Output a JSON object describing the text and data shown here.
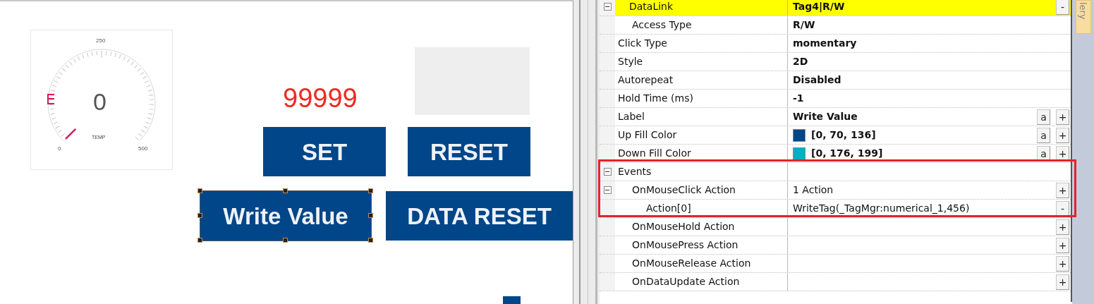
{
  "canvas": {
    "gauge": {
      "value": "0",
      "caption": "TEMP",
      "scale_min": "0",
      "scale_mid": "250",
      "scale_max": "500"
    },
    "numeric_display": {
      "value": "99999"
    },
    "buttons": [
      {
        "label": "SET",
        "selected": false
      },
      {
        "label": "RESET",
        "selected": false
      },
      {
        "label": "Write Value",
        "selected": true
      },
      {
        "label": "DATA RESET",
        "selected": false
      }
    ]
  },
  "properties": [
    {
      "name": "DataLink",
      "value": "Tag4|R/W",
      "bold": true,
      "selected": true,
      "expanded": true,
      "actions": [
        "-"
      ],
      "children": [
        {
          "name": "Access Type",
          "value": "R/W",
          "bold": true,
          "selected": false
        }
      ]
    },
    {
      "name": "Click Type",
      "value": "momentary",
      "bold": true,
      "selected": false
    },
    {
      "name": "Style",
      "value": "2D",
      "bold": true,
      "selected": false
    },
    {
      "name": "Autorepeat",
      "value": "Disabled",
      "bold": true,
      "selected": false
    },
    {
      "name": "Hold Time (ms)",
      "value": "-1",
      "bold": true,
      "selected": false
    },
    {
      "name": "Label",
      "value": "Write Value",
      "bold": true,
      "selected": false,
      "actions": [
        "a",
        "+"
      ]
    },
    {
      "name": "Up Fill Color",
      "value": "[0, 70, 136]",
      "bold": true,
      "color": "#004688",
      "selected": false,
      "actions": [
        "a",
        "+"
      ]
    },
    {
      "name": "Down Fill Color",
      "value": "[0, 176, 199]",
      "bold": true,
      "color": "#00b0c7",
      "selected": false,
      "actions": [
        "a",
        "+"
      ]
    },
    {
      "name": "Events",
      "selected": false,
      "expanded": true,
      "children": [
        {
          "name": "OnMouseClick Action",
          "value": "1 Action",
          "bold": false,
          "selected": false,
          "expanded": true,
          "actions": [
            "+"
          ],
          "children": [
            {
              "name": "Action[0]",
              "value": "WriteTag(_TagMgr:numerical_1,456)",
              "bold": false,
              "selected": false,
              "actions": [
                "-"
              ]
            }
          ]
        },
        {
          "name": "OnMouseHold Action",
          "selected": false,
          "actions": [
            "+"
          ]
        },
        {
          "name": "OnMousePress Action",
          "selected": false,
          "actions": [
            "+"
          ]
        },
        {
          "name": "OnMouseRelease Action",
          "selected": false,
          "actions": [
            "+"
          ]
        },
        {
          "name": "OnDataUpdate Action",
          "selected": false,
          "actions": [
            "+"
          ]
        }
      ]
    }
  ],
  "callout": {
    "color": "#e3232c"
  },
  "side_tab": {
    "label": "lery"
  }
}
